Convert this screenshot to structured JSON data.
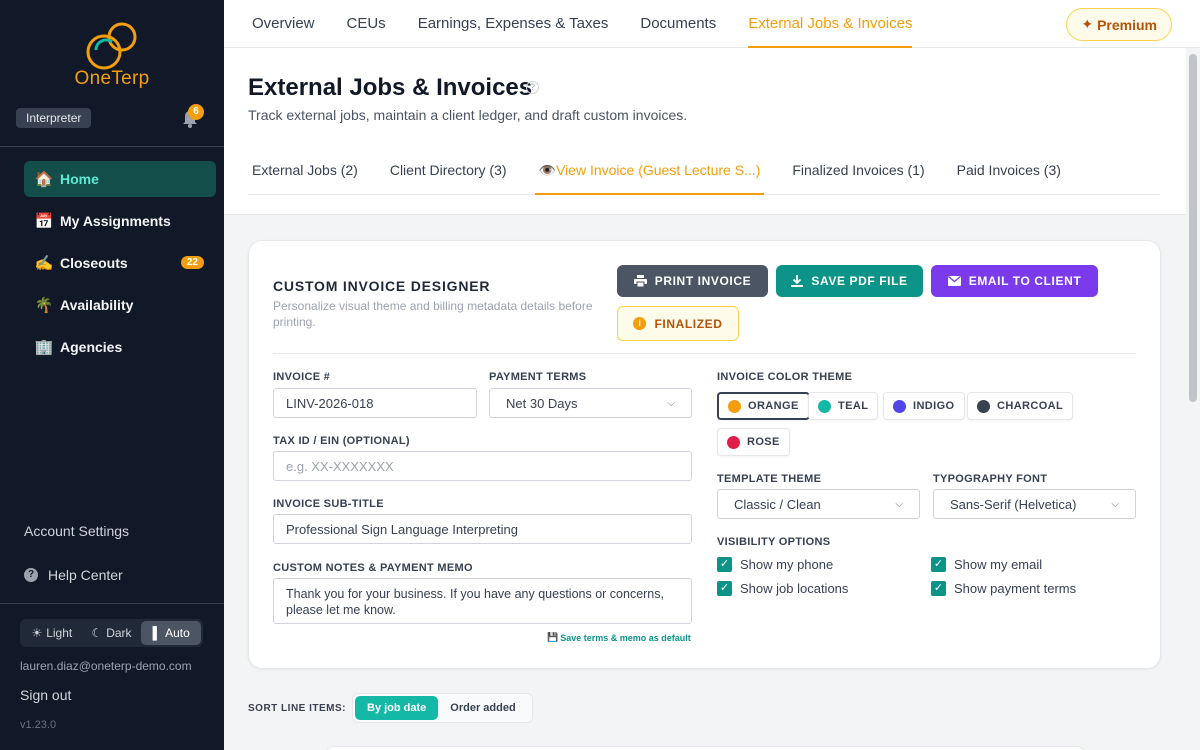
{
  "app": {
    "name": "OneTerp",
    "role": "Interpreter",
    "notifications": "6",
    "colors": {
      "accent": "#f59e0b",
      "teal": "#0d9488",
      "purple": "#7c3aed",
      "sidebar_bg": "#111827"
    }
  },
  "sidebar": {
    "items": [
      {
        "emoji": "🏠",
        "label": "Home",
        "icon": "house-icon"
      },
      {
        "emoji": "📅",
        "label": "My Assignments",
        "icon": "calendar-icon"
      },
      {
        "emoji": "✍️",
        "label": "Closeouts",
        "icon": "writing-hand-icon",
        "badge": "22"
      },
      {
        "emoji": "🌴",
        "label": "Availability",
        "icon": "palm-tree-icon"
      },
      {
        "emoji": "🏢",
        "label": "Agencies",
        "icon": "office-building-icon"
      }
    ],
    "account_settings": "Account Settings",
    "help_center": "Help Center",
    "theme": {
      "light": "Light",
      "dark": "Dark",
      "auto": "Auto"
    },
    "email": "lauren.diaz@oneterp-demo.com",
    "sign_out": "Sign out",
    "version": "v1.23.0"
  },
  "topnav": {
    "tabs": [
      "Overview",
      "CEUs",
      "Earnings, Expenses & Taxes",
      "Documents",
      "External Jobs & Invoices"
    ],
    "premium": "Premium"
  },
  "page": {
    "title": "External Jobs & Invoices",
    "help_mark": "?",
    "subtitle": "Track external jobs, maintain a client ledger, and draft custom invoices.",
    "tabs": [
      "External Jobs (2)",
      "Client Directory (3)",
      "View Invoice (Guest Lecture S...)",
      "Finalized Invoices (1)",
      "Paid Invoices (3)"
    ]
  },
  "designer": {
    "title": "CUSTOM INVOICE DESIGNER",
    "description": "Personalize visual theme and billing metadata details before printing.",
    "print": "PRINT INVOICE",
    "save_pdf": "SAVE PDF FILE",
    "email": "EMAIL TO CLIENT",
    "status": "FINALIZED",
    "invoice_number_label": "INVOICE #",
    "invoice_number": "LINV-2026-018",
    "payment_terms_label": "PAYMENT TERMS",
    "payment_terms": "Net 30 Days",
    "tax_id_label": "TAX ID / EIN (OPTIONAL)",
    "tax_id_placeholder": "e.g. XX-XXXXXXX",
    "subtitle_label": "INVOICE SUB-TITLE",
    "subtitle_value": "Professional Sign Language Interpreting",
    "notes_label": "CUSTOM NOTES & PAYMENT MEMO",
    "notes_value": "Thank you for your business. If you have any questions or concerns, please let me know.",
    "save_default": "Save terms & memo as default",
    "color_theme_label": "INVOICE COLOR THEME",
    "colors": [
      {
        "label": "ORANGE",
        "hex": "#f59e0b"
      },
      {
        "label": "TEAL",
        "hex": "#14b8a6"
      },
      {
        "label": "INDIGO",
        "hex": "#4f46e5"
      },
      {
        "label": "CHARCOAL",
        "hex": "#374151"
      },
      {
        "label": "ROSE",
        "hex": "#e11d48"
      }
    ],
    "template_label": "TEMPLATE THEME",
    "template_value": "Classic / Clean",
    "font_label": "TYPOGRAPHY FONT",
    "font_value": "Sans-Serif (Helvetica)",
    "visibility_label": "VISIBILITY OPTIONS",
    "visibility": [
      {
        "label": "Show my phone",
        "checked": true
      },
      {
        "label": "Show my email",
        "checked": true
      },
      {
        "label": "Show job locations",
        "checked": true
      },
      {
        "label": "Show payment terms",
        "checked": true
      }
    ]
  },
  "sort": {
    "label": "SORT LINE ITEMS:",
    "by_date": "By job date",
    "order_added": "Order added"
  }
}
